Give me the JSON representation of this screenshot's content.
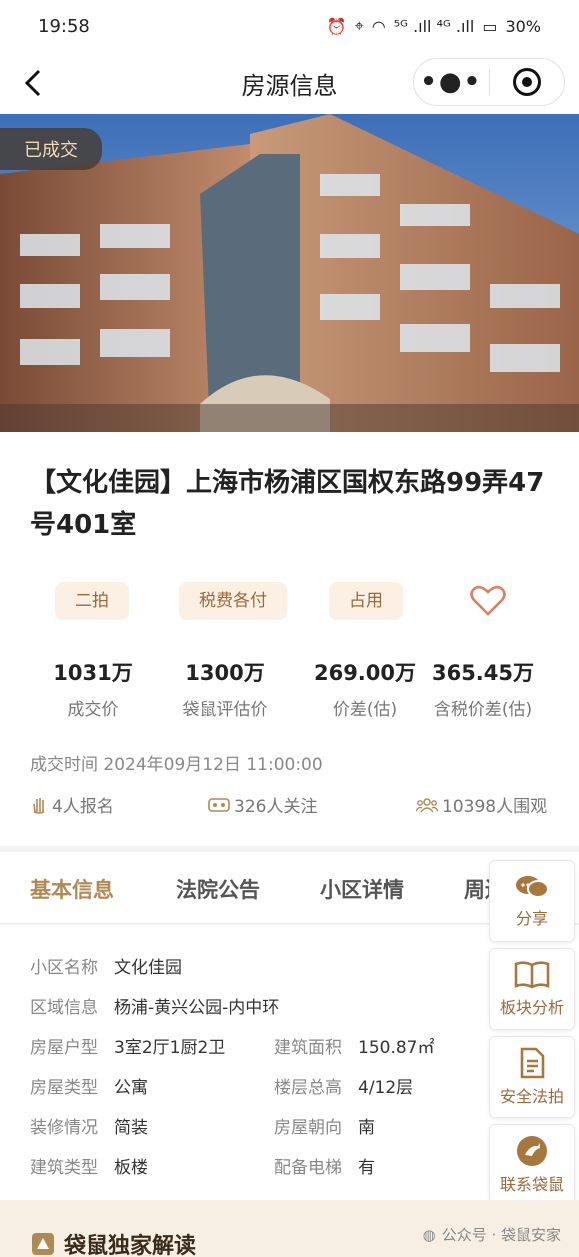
{
  "status_bar": {
    "time": "19:58",
    "network": "⁵ᴳ .ıll  ⁴ᴳ .ıll",
    "battery": "30%"
  },
  "nav": {
    "title": "房源信息",
    "more": "•●•"
  },
  "hero": {
    "badge": "已成交"
  },
  "listing": {
    "title": "【文化佳园】上海市杨浦区国权东路99弄47号401室",
    "tags": [
      "二拍",
      "税费各付",
      "占用"
    ],
    "stats": [
      {
        "value": "1031万",
        "label": "成交价"
      },
      {
        "value": "1300万",
        "label": "袋鼠评估价"
      },
      {
        "value": "269.00万",
        "label": "价差(估)"
      },
      {
        "value": "365.45万",
        "label": "含税价差(估)"
      }
    ],
    "deal_time": "成交时间 2024年09月12日 11:00:00",
    "signups": "4人报名",
    "followers": "326人关注",
    "viewers": "10398人围观"
  },
  "tabs": [
    "基本信息",
    "法院公告",
    "小区详情",
    "周边配套"
  ],
  "basic_info": {
    "community": {
      "key": "小区名称",
      "value": "文化佳园"
    },
    "area": {
      "key": "区域信息",
      "value": "杨浦-黄兴公园-内中环"
    },
    "layout": {
      "key": "房屋户型",
      "value": "3室2厅1厨2卫"
    },
    "build_area": {
      "key": "建筑面积",
      "value": "150.87㎡"
    },
    "house_type": {
      "key": "房屋类型",
      "value": "公寓"
    },
    "floors": {
      "key": "楼层总高",
      "value": "4/12层"
    },
    "decoration": {
      "key": "装修情况",
      "value": "简装"
    },
    "orientation": {
      "key": "房屋朝向",
      "value": "南"
    },
    "structure": {
      "key": "建筑类型",
      "value": "板楼"
    },
    "elevator": {
      "key": "配备电梯",
      "value": "有"
    }
  },
  "float_menu": [
    "分享",
    "板块分析",
    "安全法拍",
    "联系袋鼠"
  ],
  "bottom": {
    "title": "袋鼠独家解读",
    "watermark": "公众号 · 袋鼠安家"
  },
  "colors": {
    "accent": "#b08a55",
    "tag_bg": "#fbf0e3",
    "tag_text": "#9a6a3a",
    "heart": "#d98060"
  }
}
